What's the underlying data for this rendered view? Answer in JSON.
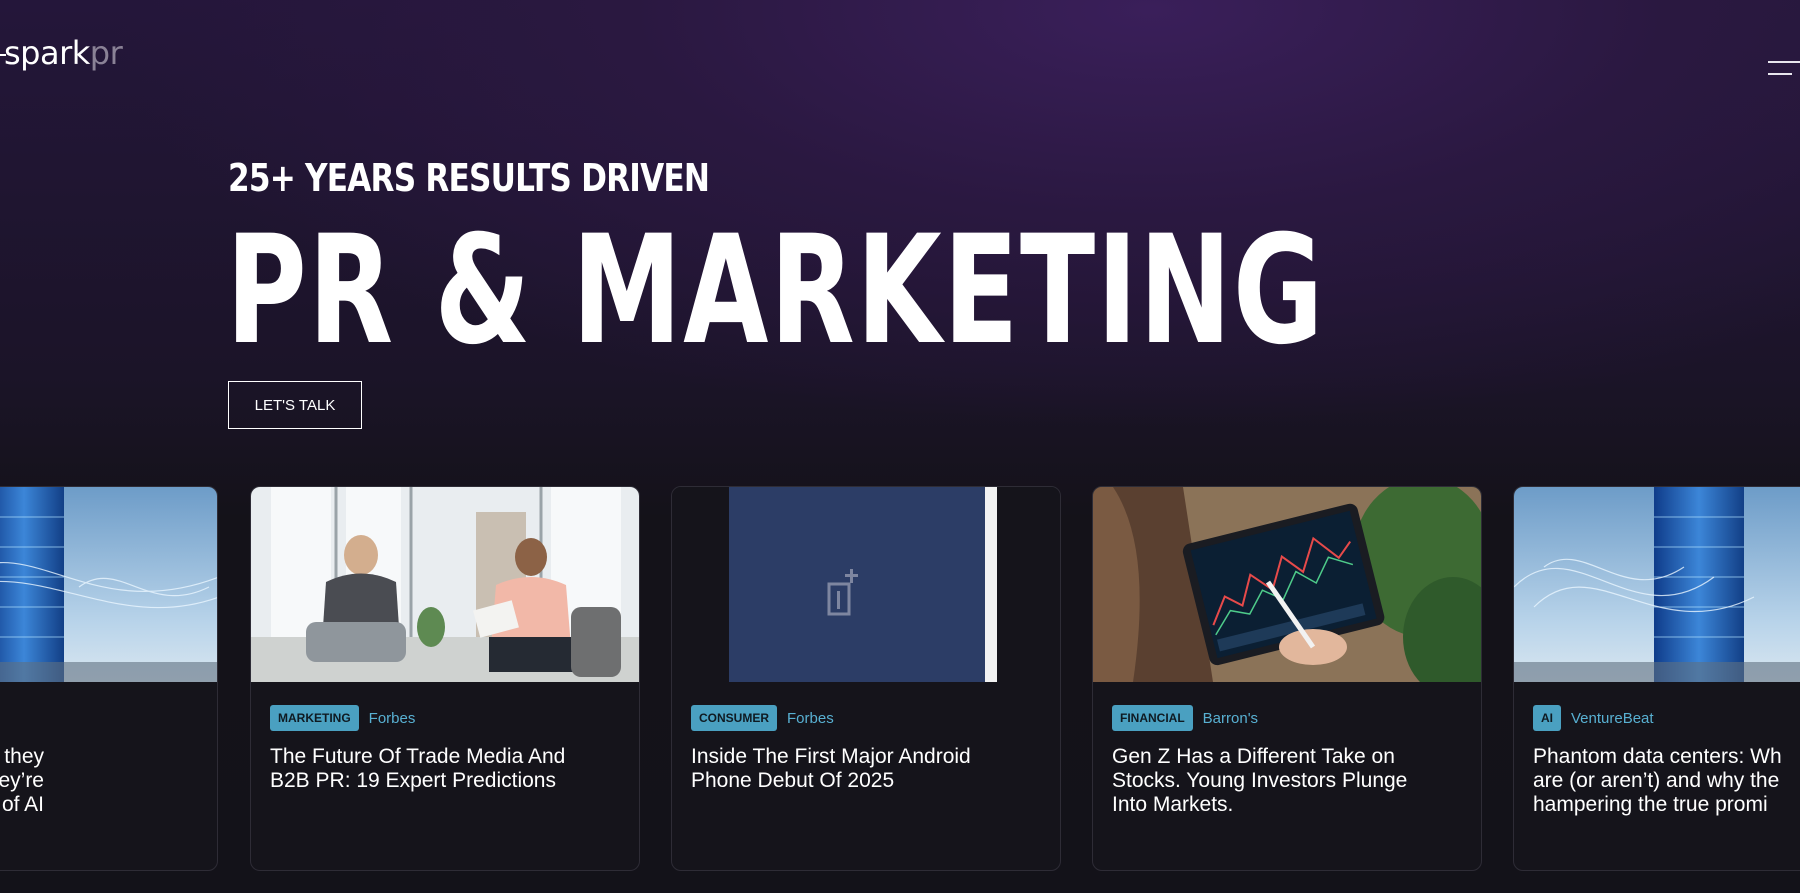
{
  "header": {
    "logo_part1": "spark",
    "logo_part2": "pr"
  },
  "hero": {
    "eyebrow": "25+ YEARS RESULTS DRIVEN",
    "headline": "PR & MARKETING",
    "cta_label": "LET'S TALK"
  },
  "cards": [
    {
      "tag": "",
      "source": "",
      "title": "centers: What they\nand why they’re\n true promise of AI",
      "image": "datacenter-tower-image"
    },
    {
      "tag": "MARKETING",
      "source": "Forbes",
      "title": "The Future Of Trade Media And\nB2B PR: 19 Expert Predictions",
      "image": "office-meeting-image"
    },
    {
      "tag": "CONSUMER",
      "source": "Forbes",
      "title": "Inside The First Major Android\nPhone Debut Of 2025",
      "image": "oneplus-phone-image"
    },
    {
      "tag": "FINANCIAL",
      "source": "Barron's",
      "title": "Gen Z Has a Different Take on\nStocks. Young Investors Plunge\nInto Markets.",
      "image": "tablet-stocks-image"
    },
    {
      "tag": "AI",
      "source": "VentureBeat",
      "title": "Phantom data centers: Wh\nare (or aren’t) and why the\nhampering the true promi",
      "image": "datacenter-tower-image"
    }
  ],
  "colors": {
    "background": "#131219",
    "hero_purple": "#2a1840",
    "tag": "#4aa0c1",
    "source_link": "#58b0d2"
  }
}
